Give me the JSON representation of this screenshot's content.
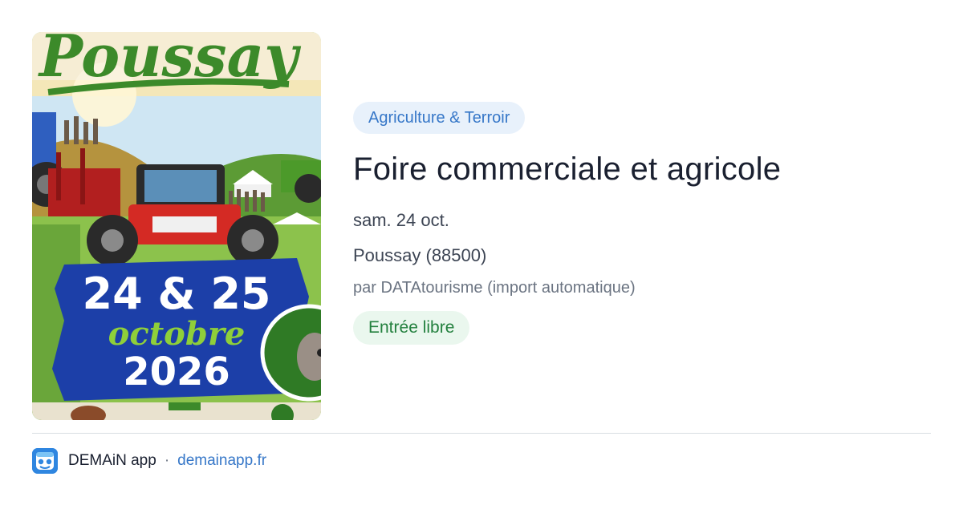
{
  "event": {
    "category": "Agriculture & Terroir",
    "title": "Foire commerciale et agricole",
    "date": "sam. 24 oct.",
    "location": "Poussay (88500)",
    "source": "par DATAtourisme (import automatique)",
    "price": "Entrée libre"
  },
  "poster": {
    "headline": "Poussay",
    "date_line1": "24 & 25",
    "date_line2": "octobre",
    "date_line3": "2026"
  },
  "footer": {
    "app_name": "DEMAiN app",
    "separator": "·",
    "site": "demainapp.fr"
  },
  "colors": {
    "accent": "#3677c8",
    "tag_bg": "#e8f1fb",
    "price_text": "#23803e",
    "price_bg": "#eaf7ee",
    "poster_blue": "#1c3fa8",
    "poster_green": "#3c8a2a"
  }
}
